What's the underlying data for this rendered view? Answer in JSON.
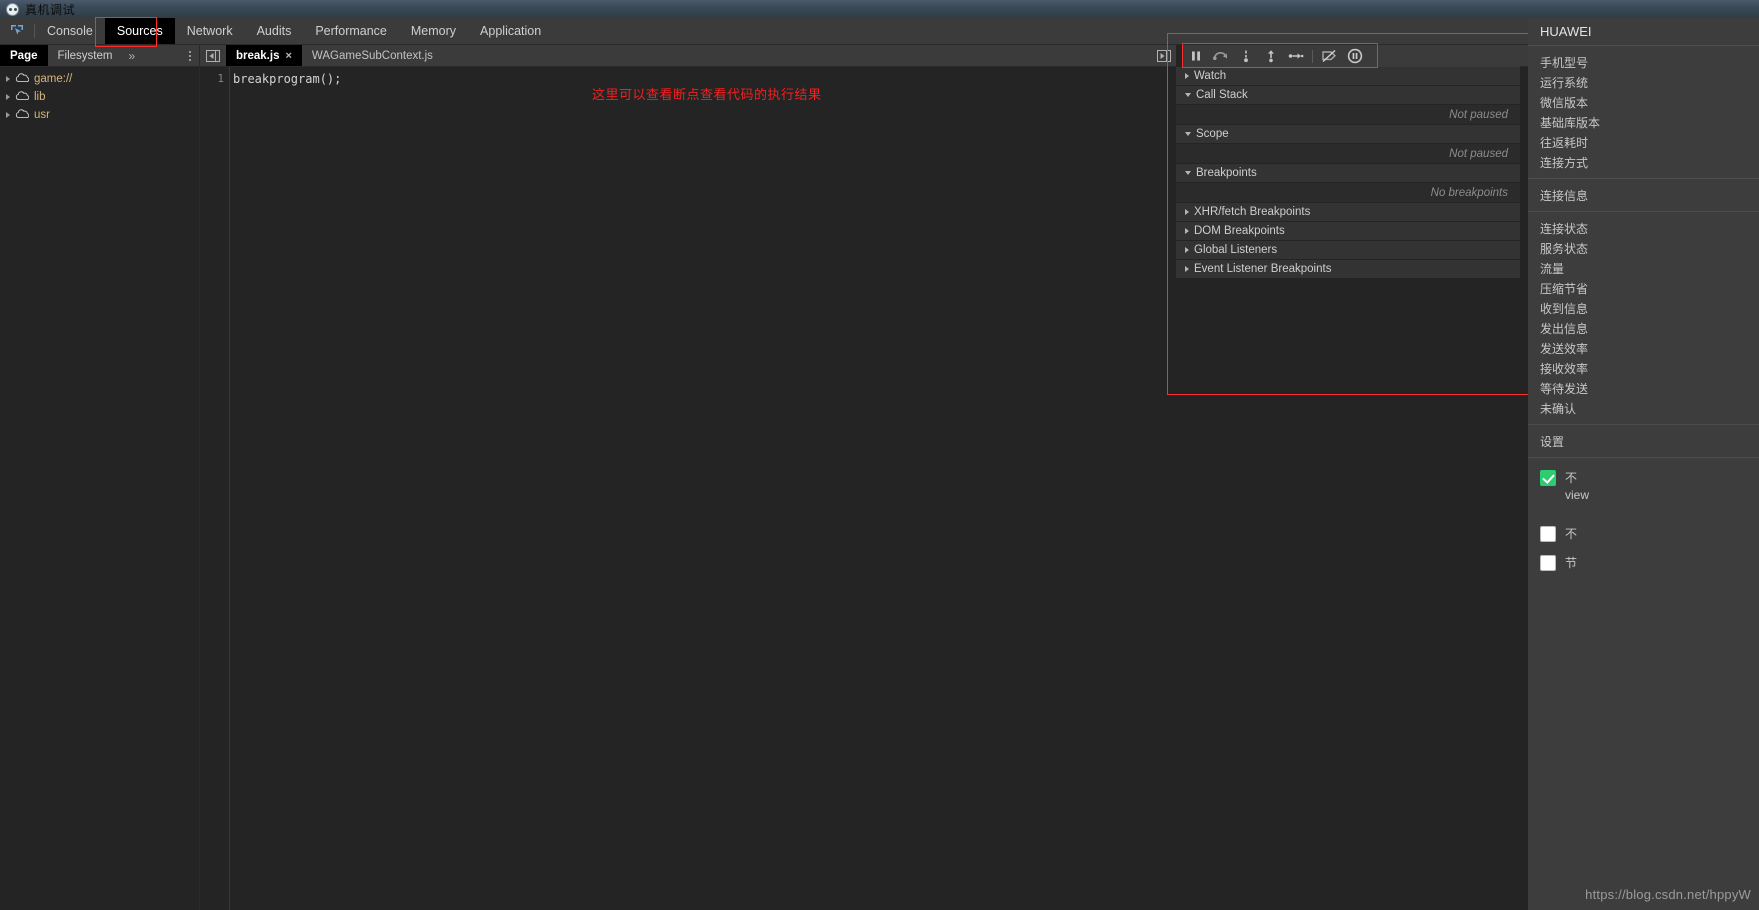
{
  "window": {
    "title": "真机调试",
    "app_icon": "panda-icon"
  },
  "devtools_tabs": {
    "inspect_icon": "inspect-cursor-icon",
    "items": [
      {
        "label": "Console",
        "active": false
      },
      {
        "label": "Sources",
        "active": true
      },
      {
        "label": "Network",
        "active": false
      },
      {
        "label": "Audits",
        "active": false
      },
      {
        "label": "Performance",
        "active": false
      },
      {
        "label": "Memory",
        "active": false
      },
      {
        "label": "Application",
        "active": false
      }
    ],
    "more_icon": "kebab-menu-icon"
  },
  "navigator": {
    "tabs": [
      {
        "label": "Page",
        "active": true
      },
      {
        "label": "Filesystem",
        "active": false
      }
    ],
    "more_label": "»",
    "kebab_icon": "kebab-menu-icon",
    "tree": [
      {
        "label": "game://",
        "icon": "cloud-icon",
        "expanded": false
      },
      {
        "label": "lib",
        "icon": "cloud-icon",
        "expanded": false
      },
      {
        "label": "usr",
        "icon": "cloud-icon",
        "expanded": false
      }
    ]
  },
  "editor": {
    "collapse_icon": "collapse-sidebar-icon",
    "tabs": [
      {
        "label": "break.js",
        "active": true,
        "close_icon": "×"
      },
      {
        "label": "WAGameSubContext.js",
        "active": false
      }
    ],
    "line_number": "1",
    "code": "breakprogram();",
    "annotation": "这里可以查看断点查看代码的执行结果",
    "annotation_color": "#f22020"
  },
  "debugger": {
    "expand_icon": "expand-sidebar-icon",
    "toolbar": [
      {
        "name": "pause-resume-button",
        "icon": "pause-icon"
      },
      {
        "name": "step-over-button",
        "icon": "step-over-icon"
      },
      {
        "name": "step-into-button",
        "icon": "step-into-icon"
      },
      {
        "name": "step-out-button",
        "icon": "step-out-icon"
      },
      {
        "name": "step-button",
        "icon": "step-icon"
      },
      {
        "name": "deactivate-breakpoints-button",
        "icon": "deactivate-breakpoints-icon"
      },
      {
        "name": "pause-on-exceptions-button",
        "icon": "pause-on-exceptions-icon"
      }
    ],
    "sections": [
      {
        "label": "Watch",
        "expanded": false,
        "empty_text": null
      },
      {
        "label": "Call Stack",
        "expanded": true,
        "empty_text": "Not paused"
      },
      {
        "label": "Scope",
        "expanded": true,
        "empty_text": "Not paused"
      },
      {
        "label": "Breakpoints",
        "expanded": true,
        "empty_text": "No breakpoints"
      },
      {
        "label": "XHR/fetch Breakpoints",
        "expanded": false,
        "empty_text": null
      },
      {
        "label": "DOM Breakpoints",
        "expanded": false,
        "empty_text": null
      },
      {
        "label": "Global Listeners",
        "expanded": false,
        "empty_text": null
      },
      {
        "label": "Event Listener Breakpoints",
        "expanded": false,
        "empty_text": null
      }
    ]
  },
  "right_panel": {
    "title": "HUAWEI",
    "device_info": [
      "手机型号",
      "运行系统",
      "微信版本",
      "基础库版本",
      "往返耗时",
      "连接方式"
    ],
    "connection_title": "连接信息",
    "connection_info": [
      "连接状态",
      "服务状态",
      "流量",
      "压缩节省",
      "收到信息",
      "发出信息",
      "发送效率",
      "接收效率",
      "等待发送",
      "未确认"
    ],
    "settings_title": "设置",
    "settings": [
      {
        "label": "不\nview",
        "checked": true
      },
      {
        "label": "不",
        "checked": false
      },
      {
        "label": "节",
        "checked": false
      }
    ]
  },
  "watermark": {
    "text": "https://blog.csdn.net/hppyW"
  }
}
